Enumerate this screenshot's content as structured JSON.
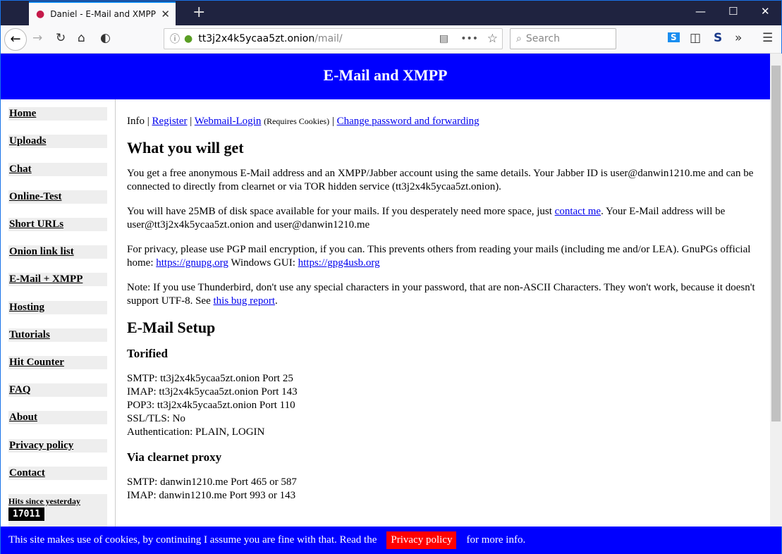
{
  "browser": {
    "tab_title": "Daniel - E-Mail and XMPP",
    "url_host": "tt3j2x4k5ycaa5zt.onion",
    "url_path": "/mail/",
    "search_placeholder": "Search"
  },
  "header": {
    "title": "E-Mail and XMPP"
  },
  "sidebar": {
    "items": [
      "Home",
      "Uploads",
      "Chat",
      "Online-Test",
      "Short URLs",
      "Onion link list",
      "E-Mail + XMPP",
      "Hosting",
      "Tutorials",
      "Hit Counter",
      "FAQ",
      "About",
      "Privacy policy",
      "Contact"
    ],
    "hits_label": "Hits since yesterday",
    "hits_value": "17011"
  },
  "content": {
    "nav": {
      "info": "Info",
      "register": "Register",
      "webmail": "Webmail-Login",
      "requires": "(Requires Cookies)",
      "change": "Change password and forwarding",
      "sep": " | "
    },
    "h_get": "What you will get",
    "p1": "You get a free anonymous E-Mail address and an XMPP/Jabber account using the same details. Your Jabber ID is user@danwin1210.me and can be connected to directly from clearnet or via TOR hidden service (tt3j2x4k5ycaa5zt.onion).",
    "p2a": "You will have 25MB of disk space available for your mails. If you desperately need more space, just ",
    "p2link": "contact me",
    "p2b": ". Your E-Mail address will be user@tt3j2x4k5ycaa5zt.onion and user@danwin1210.me",
    "p3a": "For privacy, please use PGP mail encryption, if you can. This prevents others from reading your mails (including me and/or LEA). GnuPGs official home: ",
    "p3link1": "https://gnupg.org",
    "p3b": " Windows GUI: ",
    "p3link2": "https://gpg4usb.org",
    "p4a": "Note: If you use Thunderbird, don't use any special characters in your password, that are non-ASCII Characters. They won't work, because it doesn't support UTF-8. See ",
    "p4link": "this bug report",
    "p4b": ".",
    "h_setup": "E-Mail Setup",
    "h_torified": "Torified",
    "torified": [
      "SMTP: tt3j2x4k5ycaa5zt.onion Port 25",
      "IMAP: tt3j2x4k5ycaa5zt.onion Port 143",
      "POP3: tt3j2x4k5ycaa5zt.onion Port 110",
      "SSL/TLS: No",
      "Authentication: PLAIN, LOGIN"
    ],
    "h_clearnet": "Via clearnet proxy",
    "clearnet": [
      "SMTP: danwin1210.me Port 465 or 587",
      "IMAP: danwin1210.me Port 993 or 143"
    ]
  },
  "cookie": {
    "text": "This site makes use of cookies, by continuing I assume you are fine with that. Read the",
    "button": "Privacy policy",
    "after": "for more info."
  }
}
